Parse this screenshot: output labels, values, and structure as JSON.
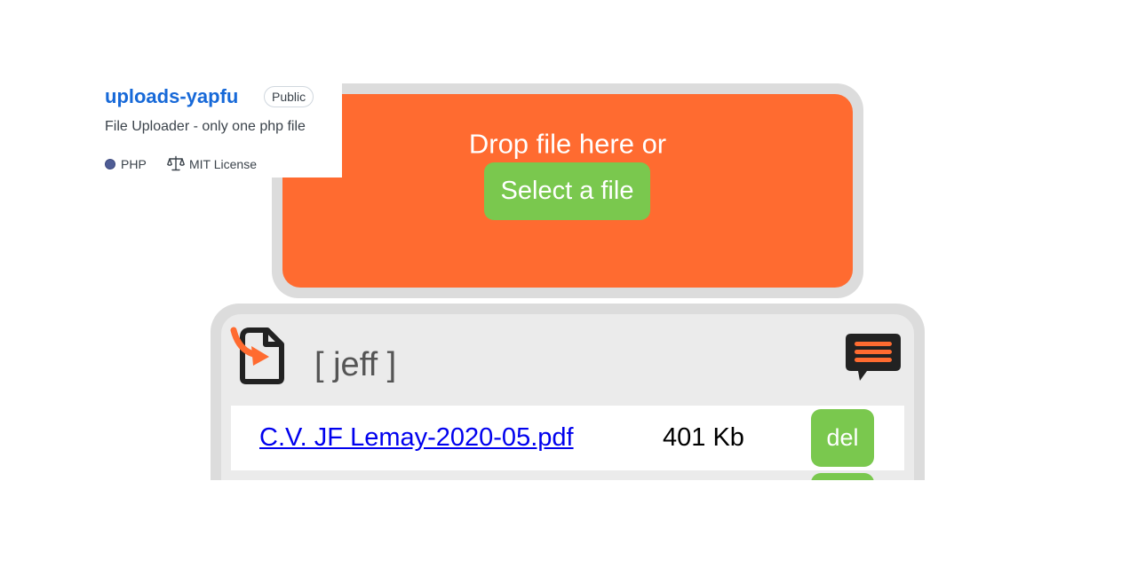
{
  "repo": {
    "name": "uploads-yapfu",
    "visibility": "Public",
    "description": "File Uploader - only one php file",
    "language": "PHP",
    "language_color": "#4f5d95",
    "license": "MIT License"
  },
  "dropzone": {
    "prompt": "Drop file here or",
    "select_label": "Select a file",
    "color": "#ff6b30"
  },
  "panel": {
    "user": "[ jeff ]",
    "files": [
      {
        "name": "C.V. JF Lemay-2020-05.pdf",
        "size": "401 Kb",
        "delete_label": "del"
      }
    ]
  },
  "colors": {
    "accent_green": "#7ac84e",
    "accent_orange": "#ff6b30",
    "link_blue": "#0000ee",
    "repo_blue": "#1769d8"
  },
  "icons": {
    "logo": "file-upload-icon",
    "chat": "chat-bubble-icon",
    "license": "scale-icon"
  }
}
